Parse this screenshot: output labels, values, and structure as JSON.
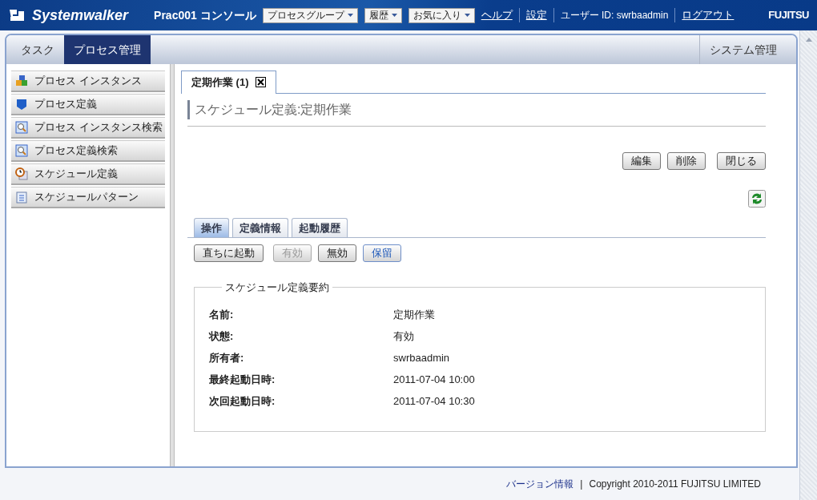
{
  "header": {
    "logo": "Systemwalker",
    "console_title": "Prac001 コンソール",
    "menus": [
      {
        "label": "プロセスグループ"
      },
      {
        "label": "履歴"
      },
      {
        "label": "お気に入り"
      }
    ],
    "links": [
      "ヘルプ",
      "設定"
    ],
    "user": "ユーザー ID: swrbaadmin",
    "logout": "ログアウト",
    "brand": "FUJITSU"
  },
  "main_tabs": [
    {
      "label": "タスク",
      "selected": false
    },
    {
      "label": "プロセス管理",
      "selected": true
    }
  ],
  "admin_tab": "システム管理",
  "sidebar": {
    "items": [
      {
        "label": "プロセス インスタンス",
        "kind": "instance"
      },
      {
        "label": "プロセス定義",
        "kind": "definition"
      },
      {
        "label": "プロセス インスタンス検索",
        "kind": "search"
      },
      {
        "label": "プロセス定義検索",
        "kind": "search"
      },
      {
        "label": "スケジュール定義",
        "kind": "schedule"
      },
      {
        "label": "スケジュールパターン",
        "kind": "pattern"
      }
    ]
  },
  "document_tab": {
    "label": "定期作業 (1)"
  },
  "page_title": "スケジュール定義:定期作業",
  "toolbar_buttons": [
    "編集",
    "削除",
    "閉じる"
  ],
  "sub_tabs": [
    {
      "label": "操作",
      "selected": true
    },
    {
      "label": "定義情報",
      "selected": false
    },
    {
      "label": "起動履歴",
      "selected": false
    }
  ],
  "actions": [
    {
      "label": "直ちに起動",
      "disabled": false,
      "focused": false
    },
    {
      "label": "有効",
      "disabled": true,
      "focused": false
    },
    {
      "label": "無効",
      "disabled": false,
      "focused": false
    },
    {
      "label": "保留",
      "disabled": false,
      "focused": true
    }
  ],
  "summary": {
    "legend": "スケジュール定義要約",
    "fields": [
      {
        "label": "名前:",
        "value": "定期作業"
      },
      {
        "label": "状態:",
        "value": "有効"
      },
      {
        "label": "所有者:",
        "value": "swrbaadmin"
      },
      {
        "label": "最終起動日時:",
        "value": "2011-07-04 10:00"
      },
      {
        "label": "次回起動日時:",
        "value": "2011-07-04 10:30"
      }
    ]
  },
  "footer": {
    "link": "バージョン情報",
    "separator": "|",
    "copyright": "Copyright 2010-2011 FUJITSU LIMITED"
  }
}
